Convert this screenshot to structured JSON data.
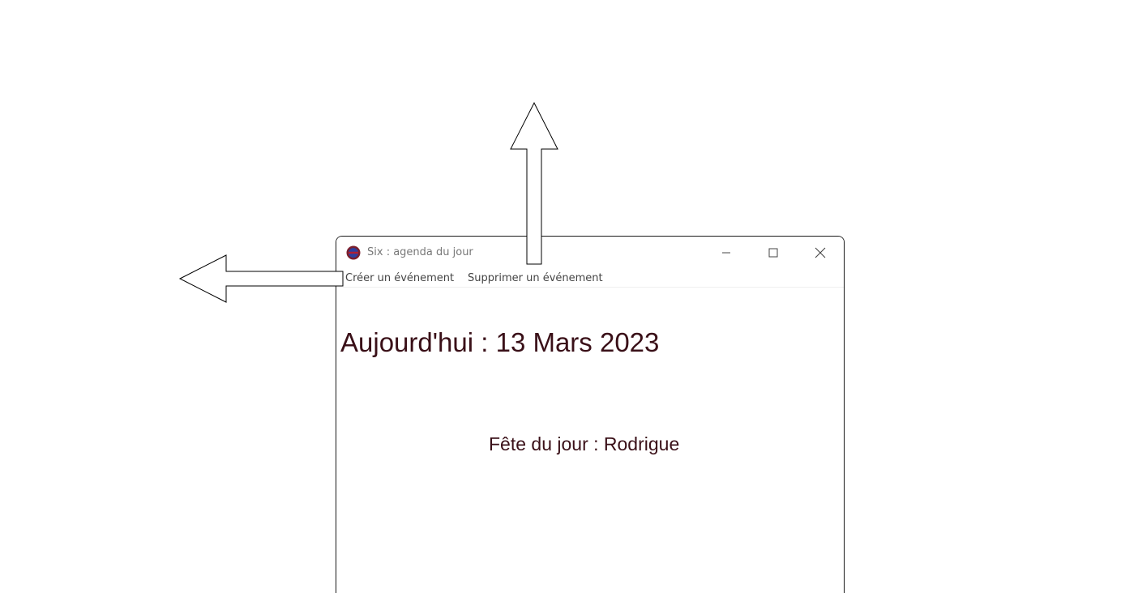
{
  "window": {
    "title": "Six : agenda du jour",
    "controls": {
      "minimize": "minimize",
      "maximize": "maximize",
      "close": "close"
    }
  },
  "menu": {
    "items": [
      {
        "label": "Créer un événement"
      },
      {
        "label": "Supprimer un événement"
      }
    ]
  },
  "content": {
    "date_heading": "Aujourd'hui : 13 Mars 2023",
    "name_day": "Fête du jour : Rodrigue"
  },
  "colors": {
    "text_accent": "#3a1018",
    "app_icon_outer": "#7a1f2e",
    "app_icon_inner": "#2e3f9e"
  },
  "annotations": {
    "arrows": [
      {
        "direction": "up",
        "icon": "up-arrow-icon"
      },
      {
        "direction": "left",
        "icon": "left-arrow-icon"
      }
    ]
  }
}
